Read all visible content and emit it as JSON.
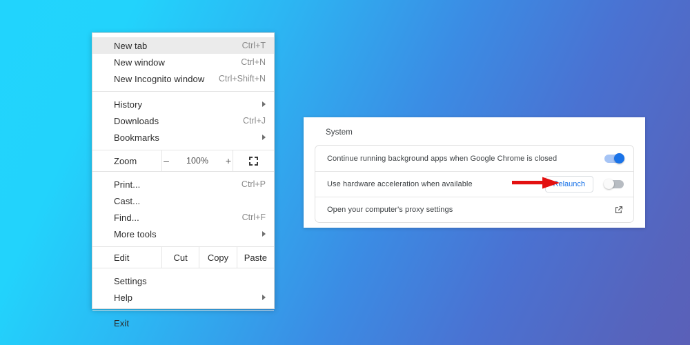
{
  "background": {
    "gradient_from": "#21d4fd",
    "gradient_to": "#5a60b8"
  },
  "chrome_menu": {
    "sections": [
      {
        "items": [
          {
            "label": "New tab",
            "accel": "Ctrl+T",
            "highlighted": true,
            "submenu": false
          },
          {
            "label": "New window",
            "accel": "Ctrl+N",
            "highlighted": false,
            "submenu": false
          },
          {
            "label": "New Incognito window",
            "accel": "Ctrl+Shift+N",
            "highlighted": false,
            "submenu": false
          }
        ]
      },
      {
        "items": [
          {
            "label": "History",
            "accel": "",
            "highlighted": false,
            "submenu": true
          },
          {
            "label": "Downloads",
            "accel": "Ctrl+J",
            "highlighted": false,
            "submenu": false
          },
          {
            "label": "Bookmarks",
            "accel": "",
            "highlighted": false,
            "submenu": true
          }
        ]
      }
    ],
    "zoom_row": {
      "label": "Zoom",
      "minus": "–",
      "level": "100%",
      "plus": "+",
      "fullscreen_icon": "fullscreen-icon"
    },
    "tools_section": {
      "items": [
        {
          "label": "Print...",
          "accel": "Ctrl+P",
          "highlighted": false,
          "submenu": false
        },
        {
          "label": "Cast...",
          "accel": "",
          "highlighted": false,
          "submenu": false
        },
        {
          "label": "Find...",
          "accel": "Ctrl+F",
          "highlighted": false,
          "submenu": false
        },
        {
          "label": "More tools",
          "accel": "",
          "highlighted": false,
          "submenu": true
        }
      ]
    },
    "edit_row": {
      "label": "Edit",
      "cut": "Cut",
      "copy": "Copy",
      "paste": "Paste"
    },
    "settings_section": {
      "items": [
        {
          "label": "Settings",
          "accel": "",
          "highlighted": false,
          "submenu": false
        },
        {
          "label": "Help",
          "accel": "",
          "highlighted": false,
          "submenu": true
        }
      ]
    },
    "exit_section": {
      "items": [
        {
          "label": "Exit",
          "accel": "",
          "highlighted": false,
          "submenu": false
        }
      ]
    }
  },
  "settings_panel": {
    "title": "System",
    "rows": [
      {
        "label": "Continue running background apps when Google Chrome is closed",
        "control": "toggle",
        "toggle_state": "on"
      },
      {
        "label": "Use hardware acceleration when available",
        "control": "relaunch-and-toggle",
        "button_label": "Relaunch",
        "toggle_state": "off"
      },
      {
        "label": "Open your computer's proxy settings",
        "control": "external-link",
        "icon": "external-link-icon"
      }
    ],
    "colors": {
      "toggle_on": "#1a73e8",
      "toggle_off": "#b7bcc2",
      "link_blue": "#1a73e8"
    }
  },
  "annotation": {
    "arrow_color": "#e31010",
    "arrow_name": "red-pointer-arrow"
  }
}
